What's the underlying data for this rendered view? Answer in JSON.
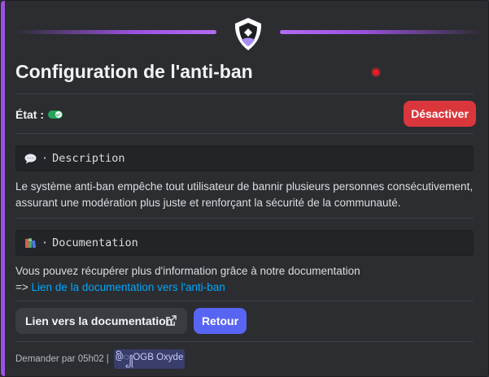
{
  "embed": {
    "accent_color": "#9b51e0",
    "banner_icon": "shield-icon",
    "title": "Configuration de l'anti-ban",
    "state": {
      "label": "État :",
      "toggle_on": true,
      "toggle_color": "#23a55a"
    },
    "deactivate_button": {
      "label": "Désactiver",
      "color": "#da373c"
    },
    "description": {
      "icon": "speech-bubble-icon",
      "separator": "·",
      "heading": "Description",
      "text": "Le système anti-ban empêche tout utilisateur de bannir plusieurs personnes consécutivement, assurant une modération plus juste et renforçant la sécurité de la communauté."
    },
    "documentation": {
      "icon": "books-icon",
      "separator": "·",
      "heading": "Documentation",
      "text": "Vous pouvez récupérer plus d'information grâce à notre documentation",
      "arrow": "=>",
      "link_text": "Lien de la documentation vers l'anti-ban"
    },
    "buttons": {
      "docs_link": {
        "label": "Lien vers la documentation",
        "icon": "external-link-icon"
      },
      "back": {
        "label": "Retour",
        "color": "#5865f2"
      }
    },
    "footer": {
      "text": "Demander par 05h02",
      "separator": "|",
      "mention": "@ꦼ꧀OGB Oxyde"
    }
  }
}
